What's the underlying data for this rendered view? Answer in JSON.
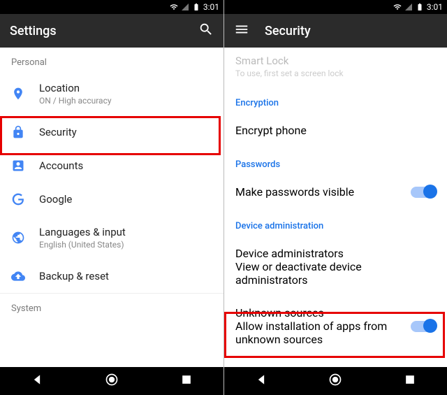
{
  "status": {
    "time": "3:01"
  },
  "left": {
    "title": "Settings",
    "sections": {
      "personal": "Personal",
      "system": "System"
    },
    "rows": {
      "location": {
        "label": "Location",
        "sublabel": "ON / High accuracy"
      },
      "security": {
        "label": "Security"
      },
      "accounts": {
        "label": "Accounts"
      },
      "google": {
        "label": "Google"
      },
      "languages": {
        "label": "Languages & input",
        "sublabel": "English (United States)"
      },
      "backup": {
        "label": "Backup & reset"
      }
    }
  },
  "right": {
    "title": "Security",
    "smartlock": {
      "label": "Smart Lock",
      "sublabel": "To use, first set a screen lock"
    },
    "encryption_header": "Encryption",
    "encrypt": {
      "label": "Encrypt phone"
    },
    "passwords_header": "Passwords",
    "passwords_visible": {
      "label": "Make passwords visible"
    },
    "device_admin_header": "Device administration",
    "device_admin": {
      "label": "Device administrators",
      "sublabel": "View or deactivate device administrators"
    },
    "unknown": {
      "label": "Unknown sources",
      "sublabel": "Allow installation of apps from unknown sources"
    }
  }
}
